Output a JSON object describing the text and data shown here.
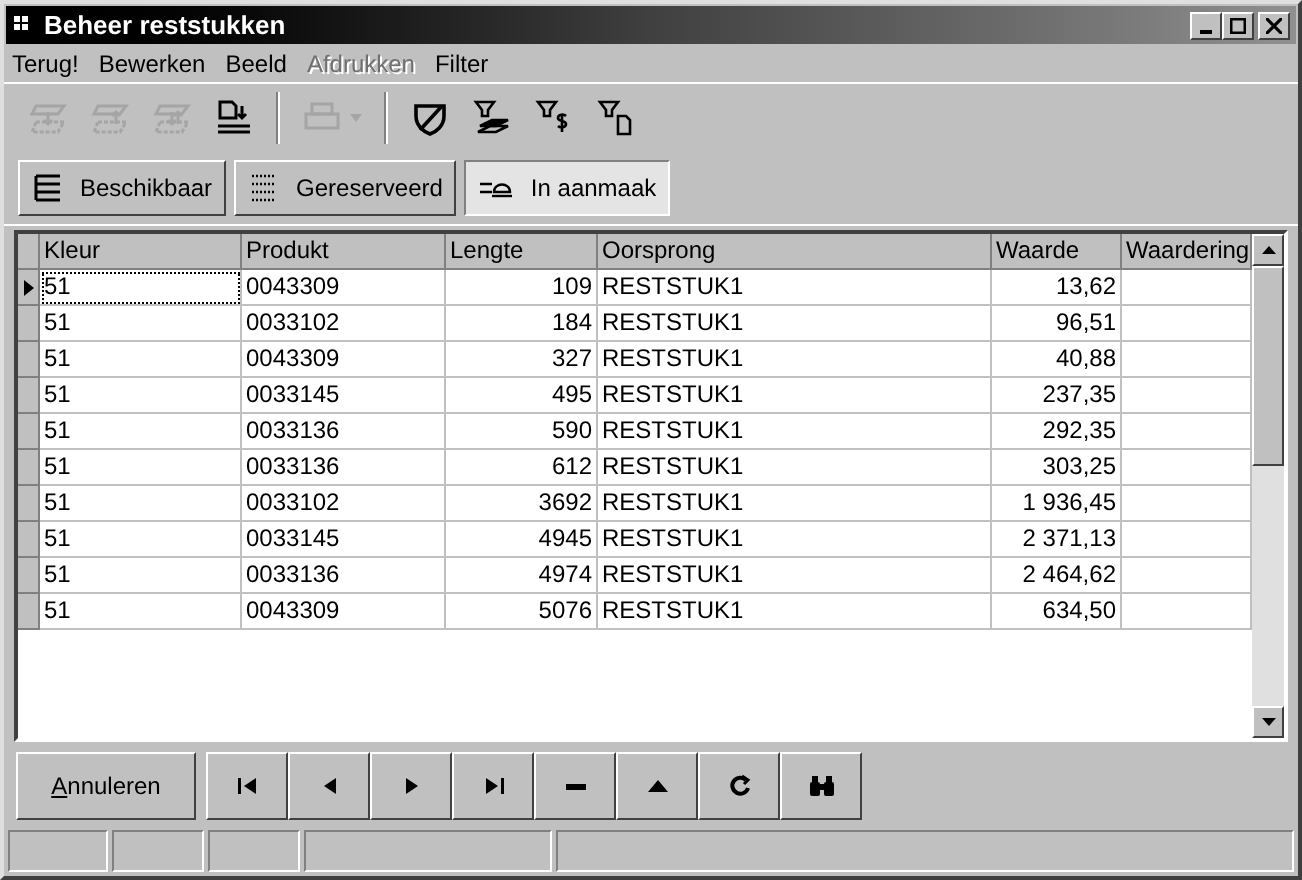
{
  "window": {
    "title": "Beheer reststukken"
  },
  "menu": [
    {
      "label": "Terug!",
      "disabled": false
    },
    {
      "label": "Bewerken",
      "disabled": false
    },
    {
      "label": "Beeld",
      "disabled": false
    },
    {
      "label": "Afdrukken",
      "disabled": true
    },
    {
      "label": "Filter",
      "disabled": false
    }
  ],
  "toolbar": [
    {
      "kind": "import-down",
      "disabled": true
    },
    {
      "kind": "import-up",
      "disabled": true
    },
    {
      "kind": "import-both",
      "disabled": true
    },
    {
      "kind": "document-transfer",
      "disabled": false
    },
    {
      "kind": "separator"
    },
    {
      "kind": "printer",
      "disabled": true
    },
    {
      "kind": "separator"
    },
    {
      "kind": "shield",
      "disabled": false
    },
    {
      "kind": "filter-stack",
      "disabled": false
    },
    {
      "kind": "filter-dollar",
      "disabled": false
    },
    {
      "kind": "filter-page",
      "disabled": false
    }
  ],
  "filters": [
    {
      "label": "Beschikbaar",
      "kind": "lines",
      "selected": false
    },
    {
      "label": "Gereserveerd",
      "kind": "hatched",
      "selected": false
    },
    {
      "label": "In aanmaak",
      "kind": "progress",
      "selected": true
    }
  ],
  "table": {
    "columns": [
      "Kleur",
      "Produkt",
      "Lengte",
      "Oorsprong",
      "Waarde",
      "Waardering"
    ],
    "rows": [
      {
        "cells": [
          "51",
          "0043309",
          "109",
          "RESTSTUK1",
          "13,62",
          ""
        ],
        "selected": true
      },
      {
        "cells": [
          "51",
          "0033102",
          "184",
          "RESTSTUK1",
          "96,51",
          ""
        ],
        "selected": false
      },
      {
        "cells": [
          "51",
          "0043309",
          "327",
          "RESTSTUK1",
          "40,88",
          ""
        ],
        "selected": false
      },
      {
        "cells": [
          "51",
          "0033145",
          "495",
          "RESTSTUK1",
          "237,35",
          ""
        ],
        "selected": false
      },
      {
        "cells": [
          "51",
          "0033136",
          "590",
          "RESTSTUK1",
          "292,35",
          ""
        ],
        "selected": false
      },
      {
        "cells": [
          "51",
          "0033136",
          "612",
          "RESTSTUK1",
          "303,25",
          ""
        ],
        "selected": false
      },
      {
        "cells": [
          "51",
          "0033102",
          "3692",
          "RESTSTUK1",
          "1 936,45",
          ""
        ],
        "selected": false
      },
      {
        "cells": [
          "51",
          "0033145",
          "4945",
          "RESTSTUK1",
          "2 371,13",
          ""
        ],
        "selected": false
      },
      {
        "cells": [
          "51",
          "0033136",
          "4974",
          "RESTSTUK1",
          "2 464,62",
          ""
        ],
        "selected": false
      },
      {
        "cells": [
          "51",
          "0043309",
          "5076",
          "RESTSTUK1",
          "634,50",
          ""
        ],
        "selected": false
      }
    ]
  },
  "cancel_button": "Annuleren",
  "navigator": [
    {
      "kind": "first"
    },
    {
      "kind": "prior"
    },
    {
      "kind": "next"
    },
    {
      "kind": "last"
    },
    {
      "kind": "delete"
    },
    {
      "kind": "edit"
    },
    {
      "kind": "refresh"
    },
    {
      "kind": "search"
    }
  ]
}
